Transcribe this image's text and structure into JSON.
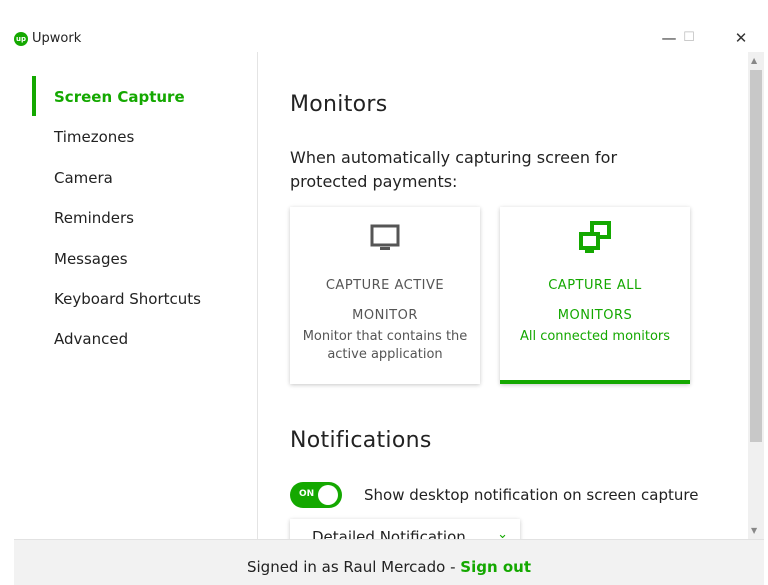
{
  "app": {
    "logo_text": "up",
    "title": "Upwork"
  },
  "window_controls": {
    "minimize": "—",
    "maximize": "☐",
    "close": "✕"
  },
  "sidebar": {
    "items": [
      {
        "label": "Screen Capture",
        "active": true
      },
      {
        "label": "Timezones"
      },
      {
        "label": "Camera"
      },
      {
        "label": "Reminders"
      },
      {
        "label": "Messages"
      },
      {
        "label": "Keyboard Shortcuts"
      },
      {
        "label": "Advanced"
      }
    ]
  },
  "monitors": {
    "heading": "Monitors",
    "subheading": "When automatically capturing screen for protected payments:",
    "options": [
      {
        "title": "CAPTURE ACTIVE MONITOR",
        "desc": "Monitor that contains the active application",
        "icon": "monitor-icon",
        "selected": false
      },
      {
        "title": "CAPTURE ALL MONITORS",
        "desc": "All connected monitors",
        "icon": "multiple-monitors-icon",
        "selected": true
      }
    ]
  },
  "notifications": {
    "heading": "Notifications",
    "toggle_state": "ON",
    "toggle_label": "Show desktop notification on screen capture",
    "dropdown_value": "Detailed Notification"
  },
  "footer": {
    "signed_in_text": "Signed in as Raul Mercado - ",
    "sign_out_label": "Sign out"
  },
  "colors": {
    "accent": "#14a800",
    "text": "#222222",
    "muted": "#555555"
  }
}
